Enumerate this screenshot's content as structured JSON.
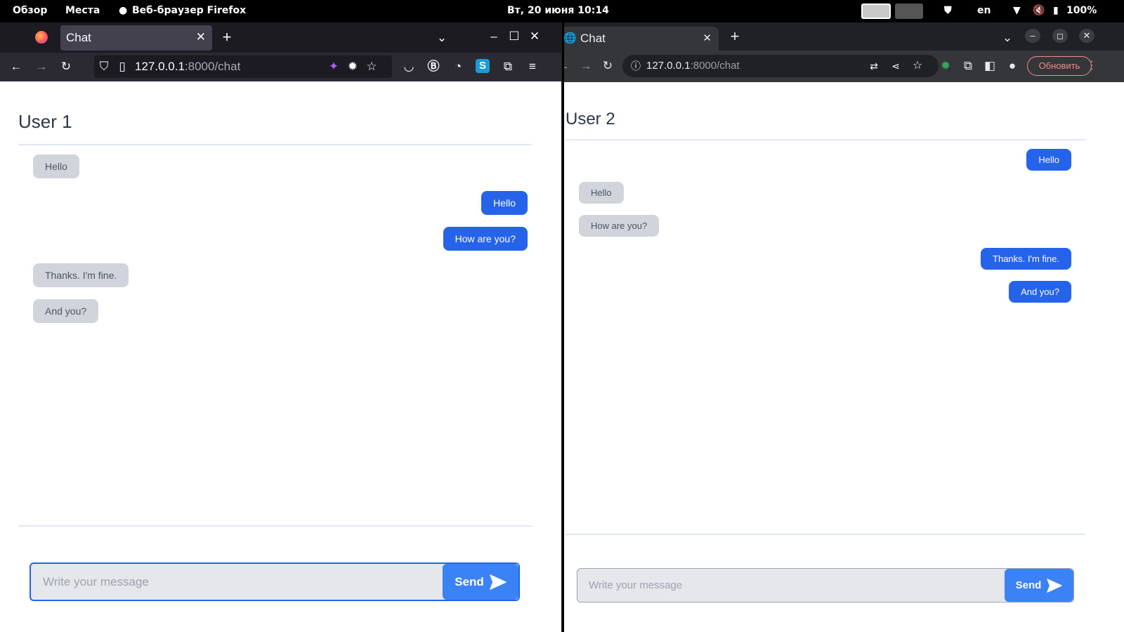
{
  "system_bar": {
    "overview": "Обзор",
    "places": "Места",
    "active_app": "Веб-браузер Firefox",
    "clock": "Вт, 20 июня  10:14",
    "keyboard_layout": "en",
    "battery": "100%"
  },
  "firefox": {
    "tab_title": "Chat",
    "url_host": "127.0.0.1",
    "url_rest": ":8000/chat"
  },
  "chrome": {
    "tab_title": "Chat",
    "url_host": "127.0.0.1",
    "url_rest": ":8000/chat",
    "update_button": "Обновить"
  },
  "chat1": {
    "title": "User 1",
    "messages": [
      {
        "side": "in",
        "text": "Hello"
      },
      {
        "side": "out",
        "text": "Hello"
      },
      {
        "side": "out",
        "text": "How are you?"
      },
      {
        "side": "in",
        "text": "Thanks. I'm fine."
      },
      {
        "side": "in",
        "text": "And you?"
      }
    ],
    "placeholder": "Write your message",
    "send_label": "Send"
  },
  "chat2": {
    "title": "User 2",
    "messages": [
      {
        "side": "out",
        "text": "Hello"
      },
      {
        "side": "in",
        "text": "Hello"
      },
      {
        "side": "in",
        "text": "How are you?"
      },
      {
        "side": "out",
        "text": "Thanks. I'm fine."
      },
      {
        "side": "out",
        "text": "And you?"
      }
    ],
    "placeholder": "Write your message",
    "send_label": "Send"
  },
  "colors": {
    "outgoing_bubble": "#2563eb",
    "incoming_bubble": "#d1d5db",
    "send_button": "#3b82f6"
  }
}
